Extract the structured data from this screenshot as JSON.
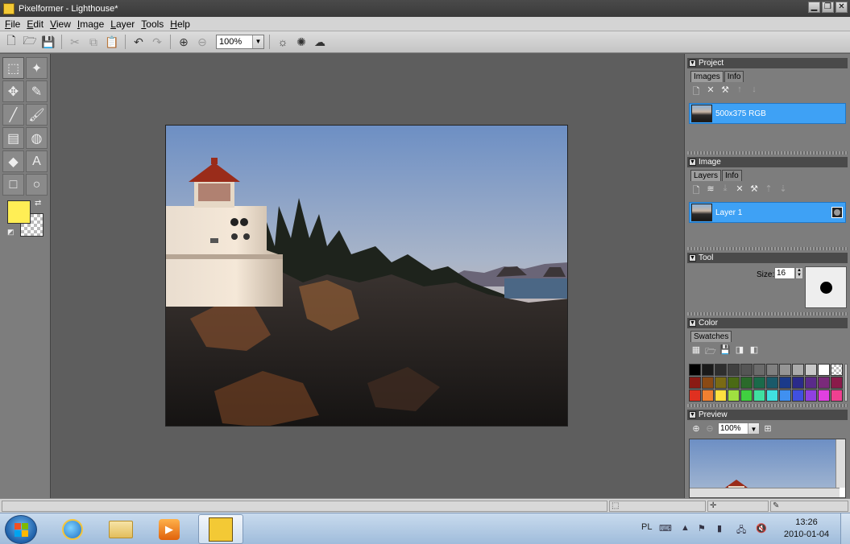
{
  "window": {
    "title": "Pixelformer - Lighthouse*",
    "buttons": {
      "minimize": "▁",
      "restore": "❐",
      "close": "✕"
    }
  },
  "menu": [
    "File",
    "Edit",
    "View",
    "Image",
    "Layer",
    "Tools",
    "Help"
  ],
  "toolbar": {
    "zoom": "100%",
    "buttons": [
      "new",
      "open",
      "save",
      "cut",
      "copy",
      "paste",
      "undo",
      "redo",
      "zoom-in",
      "zoom-out",
      "brightness",
      "sun",
      "cloud"
    ]
  },
  "tools": [
    "rect-select",
    "magic-wand",
    "move",
    "pipette",
    "line",
    "brush",
    "gradient",
    "fill",
    "eraser",
    "text",
    "rectangle",
    "ellipse"
  ],
  "colors": {
    "primary": "#ffee55",
    "secondary": "transparent"
  },
  "panels": {
    "project": {
      "title": "Project",
      "tabs": [
        "Images",
        "Info"
      ],
      "item": "500x375 RGB"
    },
    "image": {
      "title": "Image",
      "tabs": [
        "Layers",
        "Info"
      ],
      "layer": "Layer 1"
    },
    "tool": {
      "title": "Tool",
      "size_label": "Size:",
      "size_value": "16"
    },
    "color": {
      "title": "Color",
      "tabs": [
        "Swatches"
      ],
      "swatches": [
        "#000000",
        "#1a1a1a",
        "#2e2e2e",
        "#404040",
        "#555555",
        "#6b6b6b",
        "#808080",
        "#959595",
        "#aaaaaa",
        "#c8c8c8",
        "#ffffff",
        "checker",
        "#8a1a14",
        "#8a4a14",
        "#7a6a14",
        "#4a6a14",
        "#2a6a2a",
        "#1a6a4a",
        "#1a5a6a",
        "#1a3a8a",
        "#2a2a8a",
        "#5a2a8a",
        "#7a2a7a",
        "#8a1a4a",
        "#e03020",
        "#f08030",
        "#ffe040",
        "#a0e040",
        "#40d040",
        "#40e0a0",
        "#40e0e0",
        "#4090f0",
        "#4050e0",
        "#9040e0",
        "#e040e0",
        "#f04090"
      ]
    },
    "preview": {
      "title": "Preview",
      "zoom": "100%"
    }
  },
  "taskbar": {
    "language": "PL",
    "time": "13:26",
    "date": "2010-01-04"
  }
}
